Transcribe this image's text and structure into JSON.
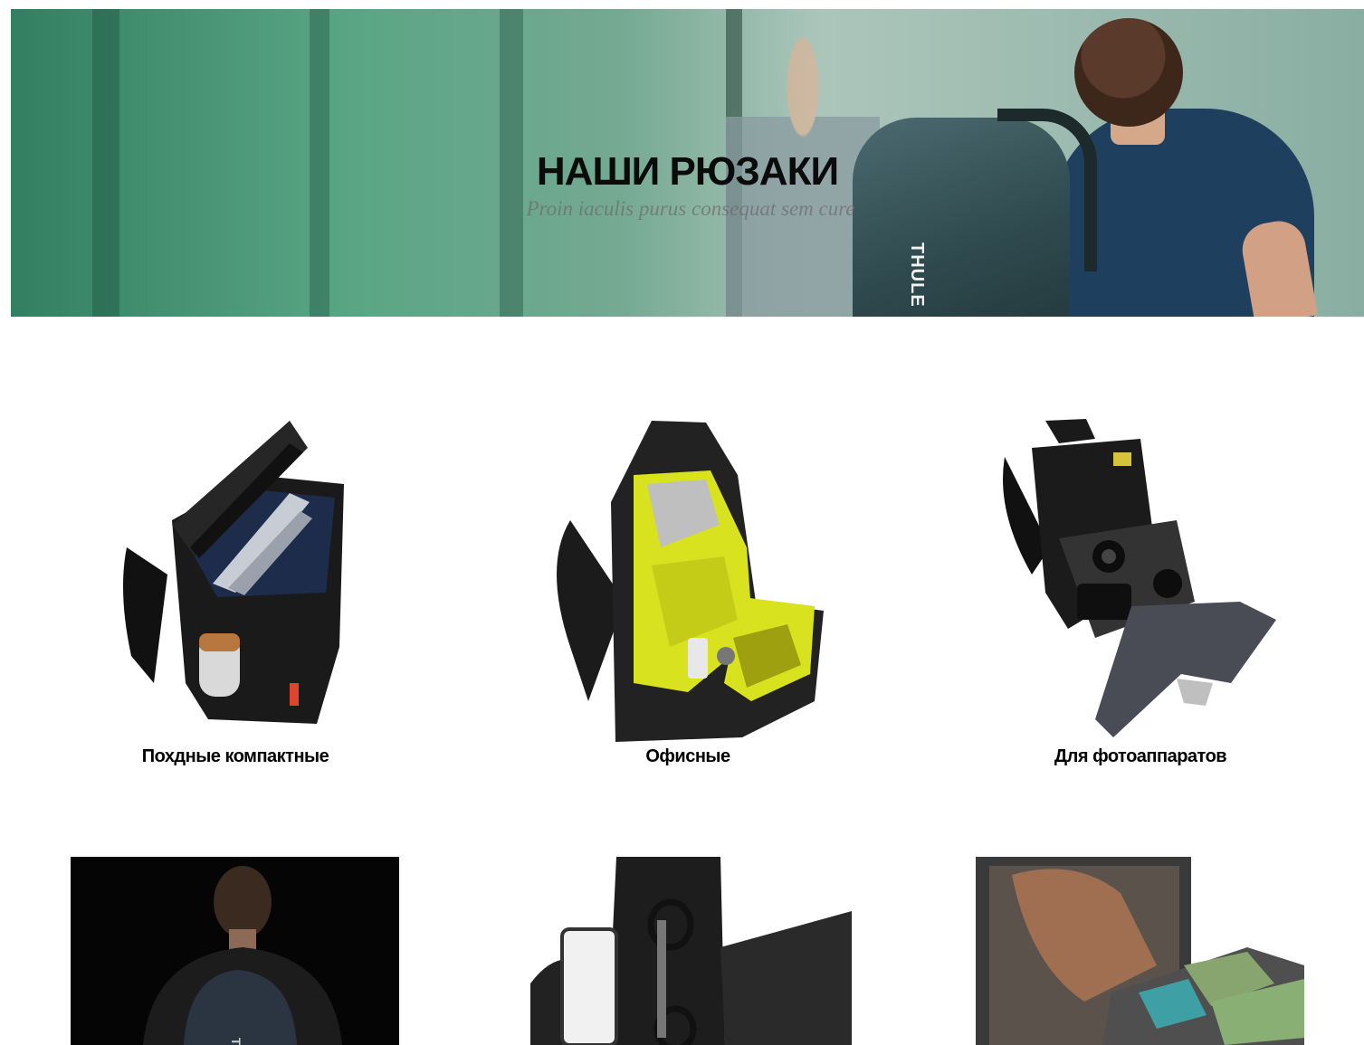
{
  "hero": {
    "title": "НАШИ РЮЗАКИ",
    "subtitle": "Proin iaculis purus consequat sem cure",
    "brand_mark": "THULE"
  },
  "categories": [
    {
      "label": "Похдные компактные",
      "image_icon": "hiking-backpack-image"
    },
    {
      "label": "Офисные",
      "image_icon": "office-backpack-image"
    },
    {
      "label": "Для фотоаппаратов",
      "image_icon": "camera-backpack-image"
    }
  ],
  "gallery": [
    {
      "image_icon": "man-with-backpack-image"
    },
    {
      "image_icon": "backpack-pockets-image"
    },
    {
      "image_icon": "open-luggage-image"
    }
  ],
  "colors": {
    "accent_yellow": "#d9e21f",
    "hero_green": "#3c9670",
    "text": "#000000"
  }
}
